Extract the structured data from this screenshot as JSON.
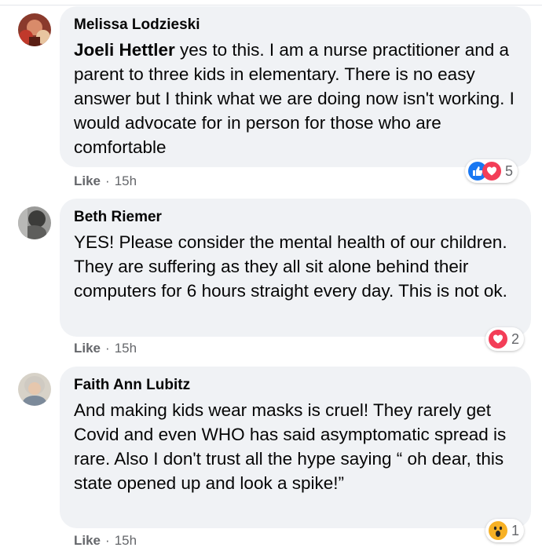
{
  "comments": [
    {
      "author": "Melissa Lodzieski",
      "mention": "Joeli Hettler",
      "text": " yes to this. I am a nurse practitioner and a parent to three kids in elementary. There is no easy answer but I think what we are doing now isn't working. I would advocate for in person for those who are comfortable",
      "like_label": "Like",
      "time": "15h",
      "reaction_count": "5",
      "reaction_icons": [
        "like-icon",
        "love-icon"
      ]
    },
    {
      "author": "Beth Riemer",
      "text": "YES! Please consider the mental health of our children. They are suffering as they all sit alone behind their computers for 6 hours straight every day. This is not ok.",
      "like_label": "Like",
      "time": "15h",
      "reaction_count": "2",
      "reaction_icons": [
        "love-icon"
      ]
    },
    {
      "author": "Faith Ann Lubitz",
      "text": "And making kids wear masks is cruel! They rarely get Covid and even WHO has said asymptomatic spread is rare. Also I don't trust all the hype saying “ oh dear, this state opened up and look a spike!”",
      "like_label": "Like",
      "time": "15h",
      "reaction_count": "1",
      "reaction_icons": [
        "wow-icon"
      ]
    }
  ],
  "colors": {
    "bubble": "#f0f2f5",
    "like_blue": "#1877f2",
    "love_red": "#f33e58",
    "wow_yellow": "#f7b125",
    "meta_gray": "#65676b"
  }
}
